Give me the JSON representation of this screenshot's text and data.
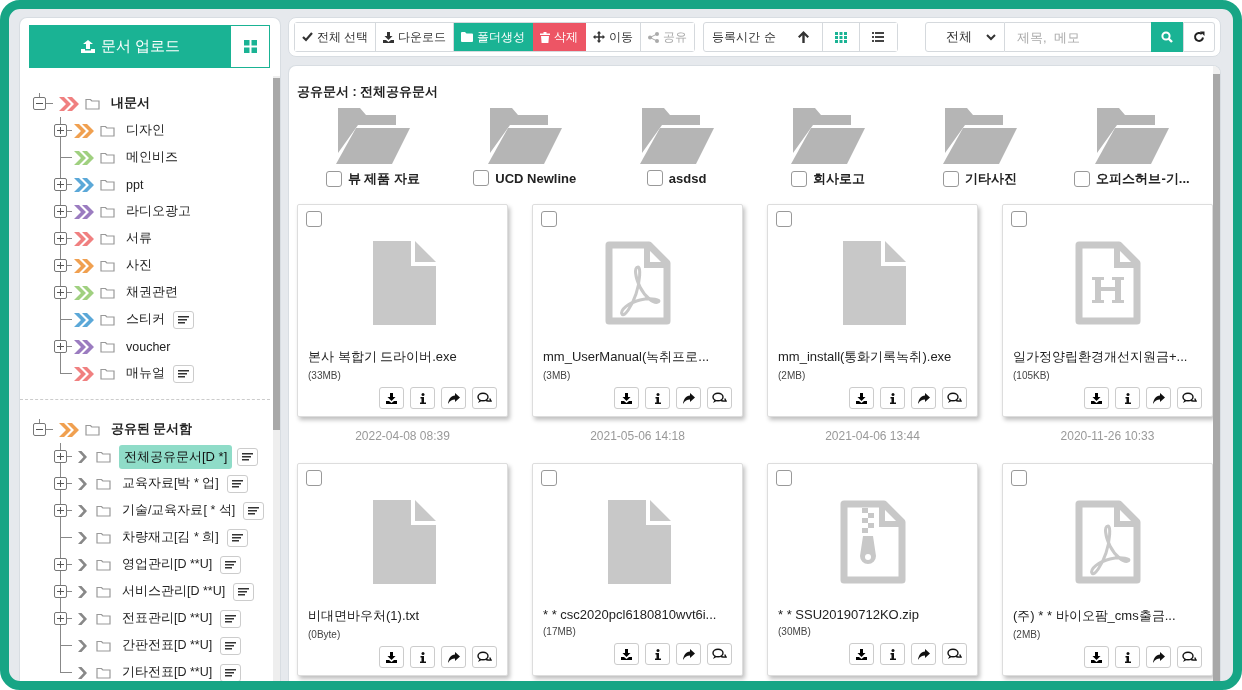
{
  "upload_button": {
    "label": "문서 업로드"
  },
  "trees": [
    {
      "label": "내문서",
      "kind": "double",
      "color": "#f08080",
      "expanded": true,
      "children": [
        {
          "label": "디자인",
          "kind": "double",
          "color": "#f0a050",
          "expanded": false
        },
        {
          "label": "메인비즈",
          "kind": "double",
          "color": "#a0d080"
        },
        {
          "label": "ppt",
          "kind": "double",
          "color": "#5ba8d8",
          "expanded": false
        },
        {
          "label": "라디오광고",
          "kind": "double",
          "color": "#9b7cc0",
          "expanded": false
        },
        {
          "label": "서류",
          "kind": "double",
          "color": "#f08080",
          "expanded": false
        },
        {
          "label": "사진",
          "kind": "double",
          "color": "#f0a050",
          "expanded": false
        },
        {
          "label": "채권관련",
          "kind": "double",
          "color": "#a0d080",
          "expanded": false
        },
        {
          "label": "스티커",
          "kind": "double",
          "color": "#5ba8d8",
          "memo": true
        },
        {
          "label": "voucher",
          "kind": "double",
          "color": "#9b7cc0",
          "expanded": false
        },
        {
          "label": "매뉴얼",
          "kind": "double",
          "color": "#f08080",
          "memo": true
        }
      ]
    },
    {
      "label": "공유된 문서함",
      "kind": "double",
      "color": "#f0a050",
      "expanded": true,
      "children": [
        {
          "label": "전체공유문서[D *]",
          "kind": "single",
          "expanded": false,
          "memo": true,
          "selected": true
        },
        {
          "label": "교육자료[박 * 업]",
          "kind": "single",
          "expanded": false,
          "memo": true,
          "selected": false
        },
        {
          "label": "기술/교육자료[ * 석]",
          "kind": "single",
          "expanded": false,
          "memo": true,
          "selected": false
        },
        {
          "label": "차량재고[김 * 희]",
          "kind": "single",
          "memo": true,
          "selected": false
        },
        {
          "label": "영업관리[D **U]",
          "kind": "single",
          "expanded": false,
          "memo": true,
          "selected": false
        },
        {
          "label": "서비스관리[D **U]",
          "kind": "single",
          "expanded": false,
          "memo": true,
          "selected": false
        },
        {
          "label": "전표관리[D **U]",
          "kind": "single",
          "expanded": false,
          "memo": true,
          "selected": false
        },
        {
          "label": "간판전표[D **U]",
          "kind": "single",
          "memo": true,
          "selected": false
        },
        {
          "label": "기타전표[D **U]",
          "kind": "single",
          "memo": true,
          "selected": false
        }
      ]
    }
  ],
  "toolbar": {
    "actions": [
      {
        "label": "전체 선택",
        "kind": "default"
      },
      {
        "label": "다운로드",
        "kind": "default"
      },
      {
        "label": "폴더생성",
        "kind": "primary"
      },
      {
        "label": "삭제",
        "kind": "danger"
      },
      {
        "label": "이동",
        "kind": "default"
      },
      {
        "label": "공유",
        "kind": "disabled"
      }
    ],
    "sort": {
      "label": "등록시간 순"
    },
    "views": [
      {
        "kind": "grid",
        "selected": true
      },
      {
        "kind": "list",
        "selected": false
      }
    ],
    "scope": {
      "value": "전체"
    },
    "search": {
      "placeholder": "제목,  메모"
    }
  },
  "content": {
    "heading": "공유문서 : 전체공유문서",
    "folders": [
      {
        "name": "뷰 제품 자료",
        "checked": false
      },
      {
        "name": "UCD Newline",
        "checked": false
      },
      {
        "name": "asdsd",
        "checked": false
      },
      {
        "name": "회사로고",
        "checked": false
      },
      {
        "name": "기타사진",
        "checked": false
      },
      {
        "name": "오피스허브-기...",
        "checked": false
      }
    ],
    "files": [
      {
        "name": "본사 복합기 드라이버.exe",
        "size": "(33MB)",
        "date": "2022-04-08 08:39",
        "kind": "file",
        "checked": false
      },
      {
        "name": "mm_UserManual(녹취프로...",
        "size": "(3MB)",
        "date": "2021-05-06 14:18",
        "kind": "pdf",
        "checked": false
      },
      {
        "name": "mm_install(통화기록녹취).exe",
        "size": "(2MB)",
        "date": "2021-04-06 13:44",
        "kind": "file",
        "checked": false
      },
      {
        "name": "일가정양립환경개선지원금+...",
        "size": "(105KB)",
        "date": "2020-11-26 10:33",
        "kind": "hwp",
        "checked": false
      },
      {
        "name": "비대면바우처(1).txt",
        "size": "(0Byte)",
        "kind": "file",
        "checked": false
      },
      {
        "name": "* * csc2020pcl6180810wvt6i...",
        "size": "(17MB)",
        "kind": "file",
        "checked": false
      },
      {
        "name": "* * SSU20190712KO.zip",
        "size": "(30MB)",
        "kind": "zip",
        "checked": false
      },
      {
        "name": "(주) * * 바이오팜_cms출금...",
        "size": "(2MB)",
        "kind": "pdf",
        "checked": false
      }
    ]
  }
}
